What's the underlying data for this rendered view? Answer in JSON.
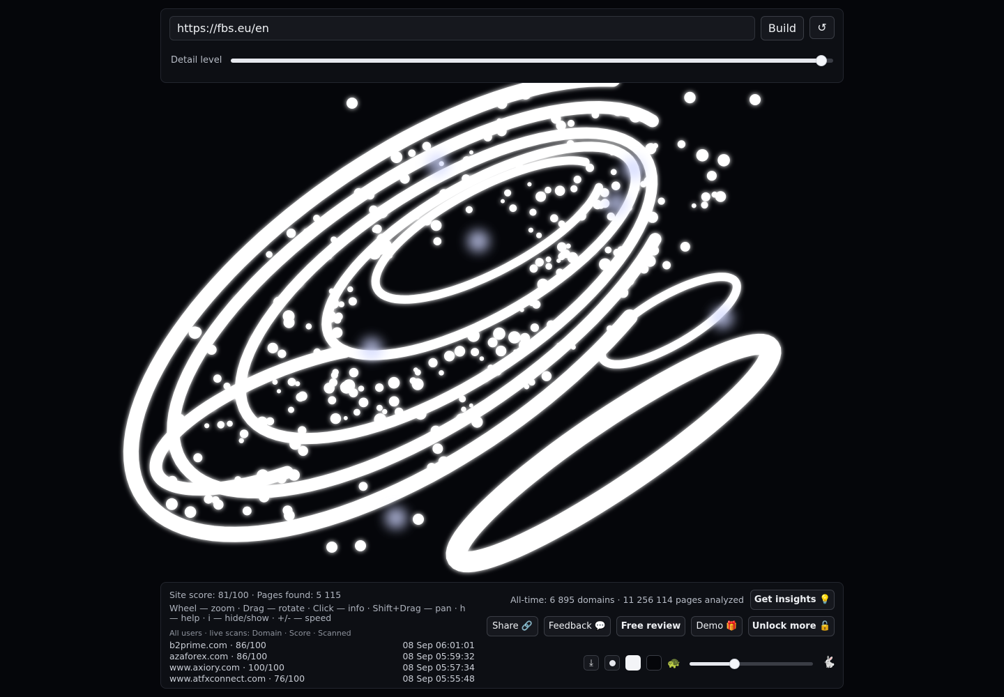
{
  "toolbar": {
    "url_value": "https://fbs.eu/en",
    "build_label": "Build",
    "reset_icon": "↺",
    "detail_label": "Detail level",
    "detail_level": 0.98
  },
  "info": {
    "stats": "Site score: 81/100 · Pages found: 5 115",
    "help": "Wheel — zoom · Drag — rotate · Click — info · Shift+Drag — pan · h — help · i — hide/show · +/- — speed",
    "feed_header": "All users · live scans: Domain · Score · Scanned",
    "feed": [
      {
        "domain": "b2prime.com · 86/100",
        "time": "08 Sep 06:01:01"
      },
      {
        "domain": "azaforex.com · 86/100",
        "time": "08 Sep 05:59:32"
      },
      {
        "domain": "www.axiory.com · 100/100",
        "time": "08 Sep 05:57:34"
      },
      {
        "domain": "www.atfxconnect.com · 76/100",
        "time": "08 Sep 05:55:48"
      }
    ],
    "alltime": "All-time: 6 895 domains · 11 256 114 pages analyzed",
    "insights_label": "Get insights 💡",
    "share_label": "Share 🔗",
    "feedback_label": "Feedback 💬",
    "review_label": "Free review",
    "demo_label": "Demo 🎁",
    "unlock_label": "Unlock more 🔓"
  },
  "controls": {
    "download_icon": "⤓",
    "turtle_icon": "🐢",
    "rabbit_icon": "🐇",
    "speed_level": 0.36
  },
  "colors": {
    "background": "#05060a",
    "glow": "#ffffff",
    "panel": "#0d0f14"
  }
}
